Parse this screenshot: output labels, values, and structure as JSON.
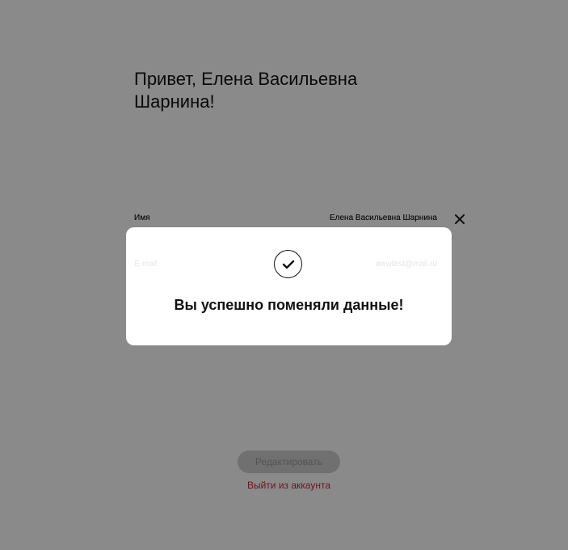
{
  "profile": {
    "greeting": "Привет, Елена Васильевна Шарнина!",
    "fields": [
      {
        "label": "Имя",
        "value": "Елена Васильевна Шарнина"
      },
      {
        "label": "E-mail",
        "value": "awwtest@mail.ru"
      }
    ],
    "edit_label": "Редактировать",
    "logout_label": "Выйти из аккаунта"
  },
  "modal": {
    "icon": "check-icon",
    "close_icon": "close-icon",
    "message": "Вы успешно поменяли данные!"
  },
  "colors": {
    "overlay": "#8a8a8a",
    "logout": "#c4283a",
    "modal_bg": "#ffffff"
  }
}
